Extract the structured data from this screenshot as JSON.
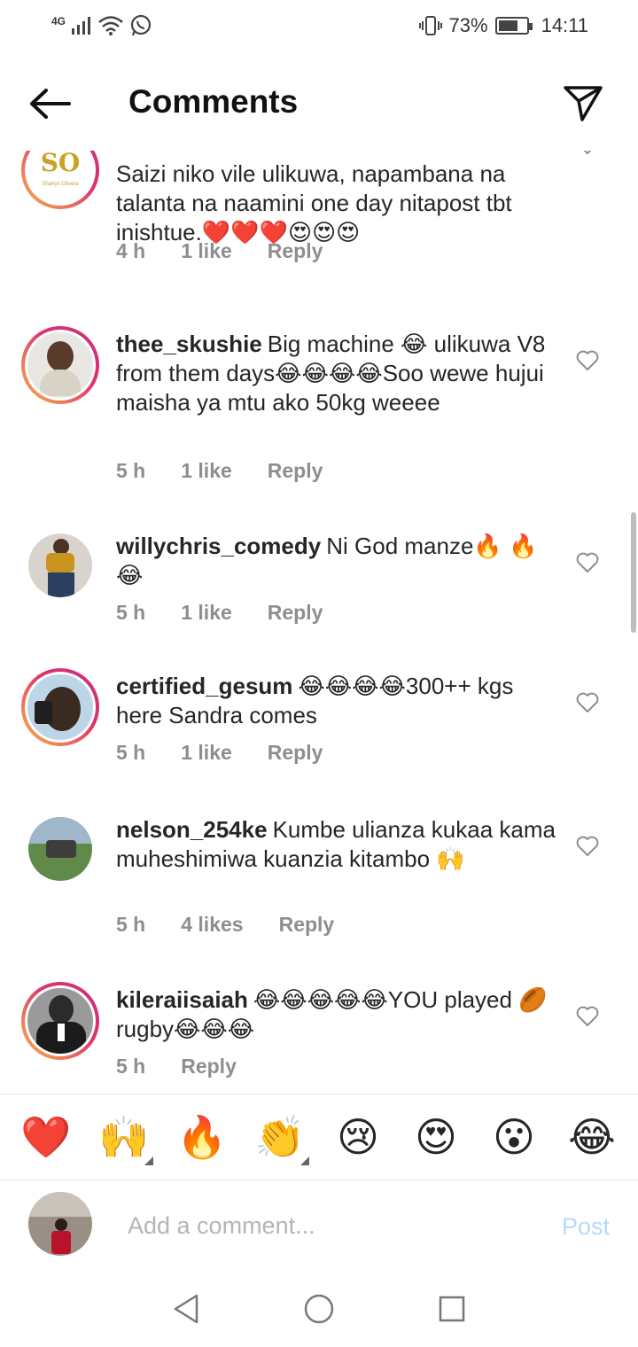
{
  "status_bar": {
    "network": "4G",
    "battery": "73%",
    "battery_level": 0.73,
    "time": "14:11"
  },
  "header": {
    "title": "Comments",
    "back_icon": "arrow-left-icon",
    "share_icon": "paper-plane-icon"
  },
  "comments": [
    {
      "username": "",
      "text": "Saizi niko vile ulikuwa, napambana na talanta na naamini one day nitapost tbt inishtue.❤️❤️❤️😍😍😍",
      "time": "4 h",
      "likes": "1 like",
      "reply": "Reply",
      "avatar_text": "SO",
      "avatar_caption": "Sharlyn Olivera"
    },
    {
      "username": "thee_skushie",
      "text": "Big machine 😂 ulikuwa V8 from them days😂😂😂😂Soo wewe hujui maisha ya mtu ako 50kg weeee",
      "time": "5 h",
      "likes": "1 like",
      "reply": "Reply"
    },
    {
      "username": "willychris_comedy",
      "text": "Ni God manze🔥 🔥 😂",
      "time": "5 h",
      "likes": "1 like",
      "reply": "Reply"
    },
    {
      "username": "certified_gesum",
      "text": "😂😂😂😂300++ kgs here Sandra comes",
      "time": "5 h",
      "likes": "1 like",
      "reply": "Reply"
    },
    {
      "username": "nelson_254ke",
      "text": "Kumbe ulianza kukaa kama muheshimiwa kuanzia kitambo 🙌",
      "time": "5 h",
      "likes": "4 likes",
      "reply": "Reply"
    },
    {
      "username": "kileraiisaiah",
      "text": "😂😂😂😂😂YOU played 🏉 rugby😂😂😂",
      "time": "5 h",
      "likes": "",
      "reply": "Reply"
    }
  ],
  "emoji_bar": [
    "❤️",
    "🙌",
    "🔥",
    "👏",
    "😢",
    "😍",
    "😮",
    "😂"
  ],
  "input": {
    "placeholder": "Add a comment...",
    "post_label": "Post"
  },
  "colors": {
    "post_disabled": "#b3dbff",
    "meta_gray": "#8e8e8e",
    "story_ring_start": "#f7b84b",
    "story_ring_end": "#c13584"
  }
}
